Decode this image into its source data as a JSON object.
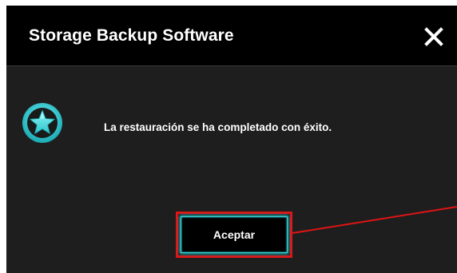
{
  "dialog": {
    "title": "Storage Backup Software",
    "close_icon": "close-icon",
    "status_icon": "star-icon",
    "message": "La restauración se ha completado con éxito.",
    "accept_label": "Aceptar"
  },
  "colors": {
    "titlebar": "#000000",
    "body": "#1e1e1e",
    "accent": "#35d6dc",
    "highlight": "#e01414"
  }
}
